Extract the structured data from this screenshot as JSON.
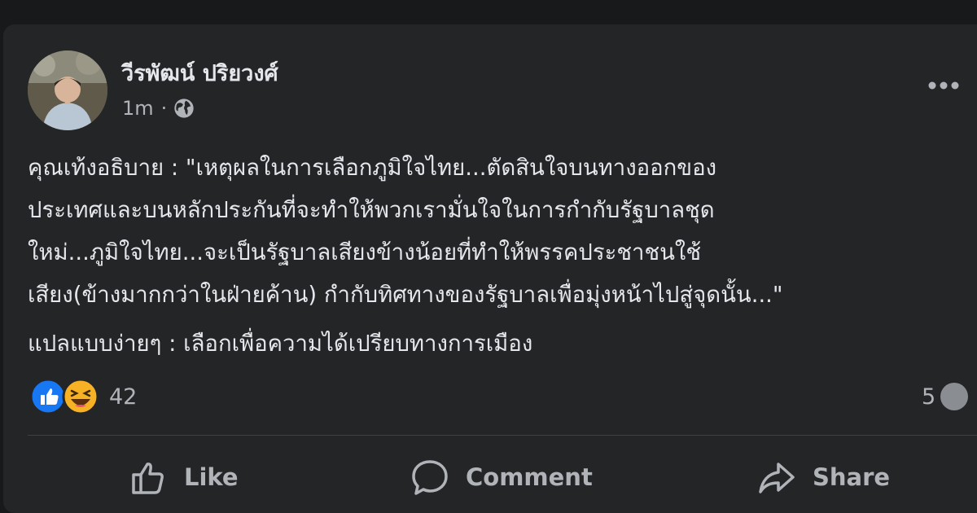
{
  "post": {
    "author": "วีรพัฒน์ ปริยวงศ์",
    "timestamp": "1m",
    "audience_icon": "globe-icon",
    "paragraph1_lines": [
      "คุณเท้งอธิบาย : \"เหตุผลในการเลือกภูมิใจไทย...ตัดสินใจบนทางออกของ",
      "ประเทศและบนหลักประกันที่จะทำให้พวกเรามั่นใจในการกำกับรัฐบาลชุด",
      "ใหม่...ภูมิใจไทย...จะเป็นรัฐบาลเสียงข้างน้อยที่ทำให้พรรคประชาชนใช้",
      "เสียง(ข้างมากกว่าในฝ่ายค้าน) กำกับทิศทางของรัฐบาลเพื่อมุ่งหน้าไปสู่จุดนั้น...\""
    ],
    "paragraph2": "แปลแบบง่ายๆ : เลือกเพื่อความได้เปรียบทางการเมือง"
  },
  "stats": {
    "reaction_count": "42",
    "comment_count": "5",
    "reaction_icons": [
      "like-reaction-icon",
      "haha-reaction-icon"
    ]
  },
  "actions": {
    "like_label": "Like",
    "comment_label": "Comment",
    "share_label": "Share"
  },
  "colors": {
    "background": "#18191a",
    "card": "#242526",
    "text_primary": "#e4e6eb",
    "text_secondary": "#b0b3b8",
    "like_blue": "#1877f2",
    "haha_yellow": "#f7b125"
  }
}
